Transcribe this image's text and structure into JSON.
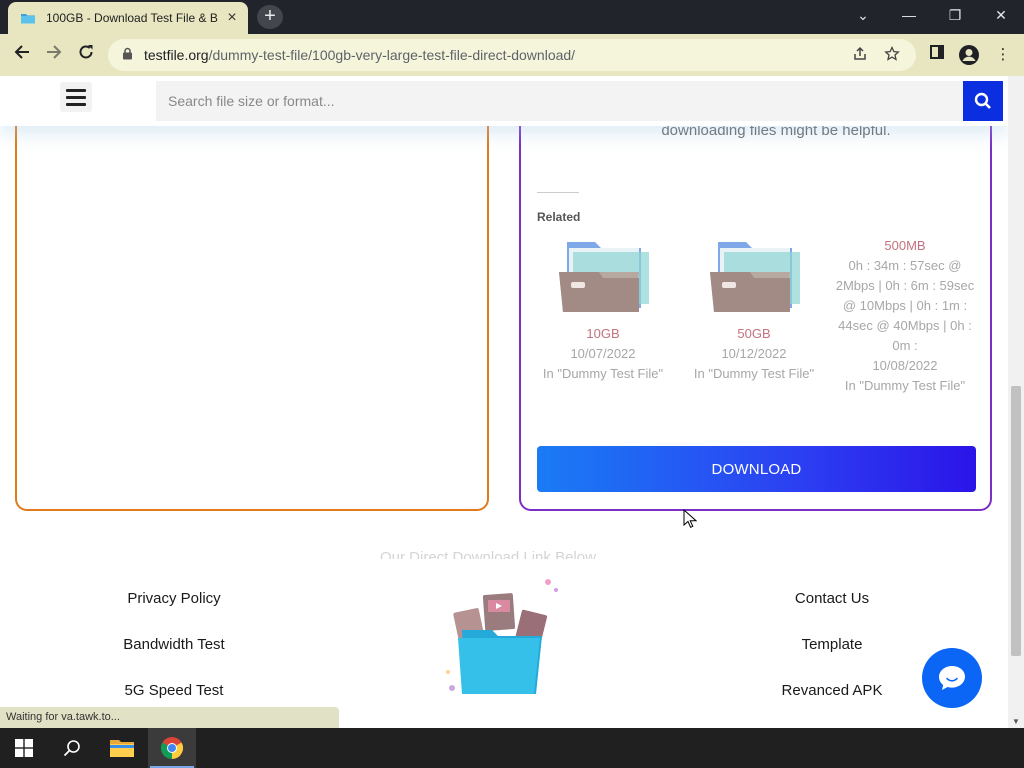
{
  "browser": {
    "tab_title": "100GB - Download Test File & B",
    "new_tab_symbol": "+",
    "url_host": "testfile.org",
    "url_path": "/dummy-test-file/100gb-very-large-test-file-direct-download/",
    "status_text": "Waiting for va.tawk.to..."
  },
  "site": {
    "search_placeholder": "Search file size or format...",
    "helpful_text": "downloading files might be helpful.",
    "related_heading": "Related",
    "related": [
      {
        "title": "10GB",
        "date": "10/07/2022",
        "category": "In \"Dummy Test File\""
      },
      {
        "title": "50GB",
        "date": "10/12/2022",
        "category": "In \"Dummy Test File\""
      },
      {
        "title": "500MB",
        "description": "0h : 34m : 57sec @ 2Mbps | 0h : 6m : 59sec @ 10Mbps | 0h : 1m : 44sec @ 40Mbps | 0h : 0m :",
        "date": "10/08/2022",
        "category": "In \"Dummy Test File\""
      }
    ],
    "download_label": "DOWNLOAD",
    "faded_heading": "Our Direct Download Link Below",
    "footer_left": [
      "Privacy Policy",
      "Bandwidth Test",
      "5G Speed Test"
    ],
    "footer_right": [
      "Contact Us",
      "Template",
      "Revanced APK"
    ]
  },
  "colors": {
    "accent_blue": "#0b2fe0",
    "left_card_border": "#e07b1d",
    "right_card_border": "#7b2fc7",
    "link_pink": "#c4727f",
    "chat_blue": "#0b65f5"
  },
  "icons": {
    "tab_favicon": "folder-favicon-icon",
    "search": "search-icon",
    "chat": "chat-bubble-icon",
    "menu": "hamburger-menu-icon"
  }
}
